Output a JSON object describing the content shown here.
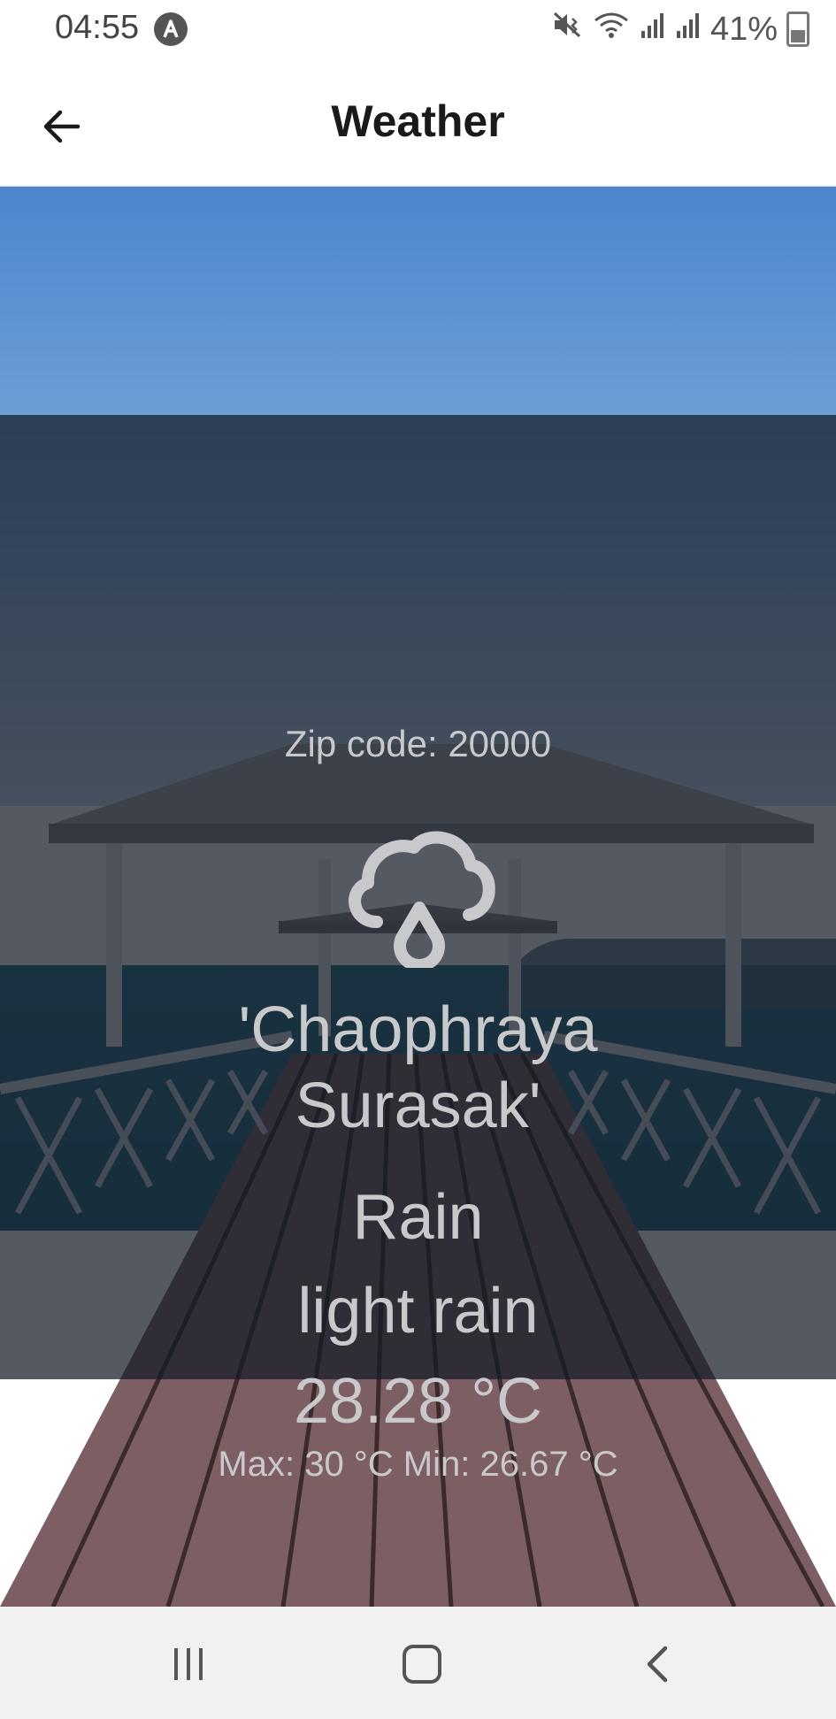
{
  "status_bar": {
    "time": "04:55",
    "battery": "41%",
    "icons": [
      "app-notification-icon",
      "mute-vibrate-icon",
      "wifi-icon",
      "signal-icon",
      "signal-icon",
      "battery-icon"
    ]
  },
  "app_bar": {
    "title": "Weather",
    "back_icon": "arrow-left-icon"
  },
  "weather": {
    "zip_label": "Zip code: 20000",
    "icon": "cloud-rain-icon",
    "city_line1": "'Chaophraya",
    "city_line2": "Surasak'",
    "condition": "Rain",
    "description": "light rain",
    "temperature": "28.28 °C",
    "minmax": "Max: 30 °C  Min: 26.67 °C"
  },
  "nav_bar": {
    "icons": [
      "recent-apps-icon",
      "home-icon",
      "back-chevron-icon"
    ]
  },
  "colors": {
    "sky": "#5a8fd0",
    "overlay": "rgba(20,26,38,0.72)",
    "text_on_overlay": "#c9c9cc",
    "deck": "#8a6a6e"
  }
}
